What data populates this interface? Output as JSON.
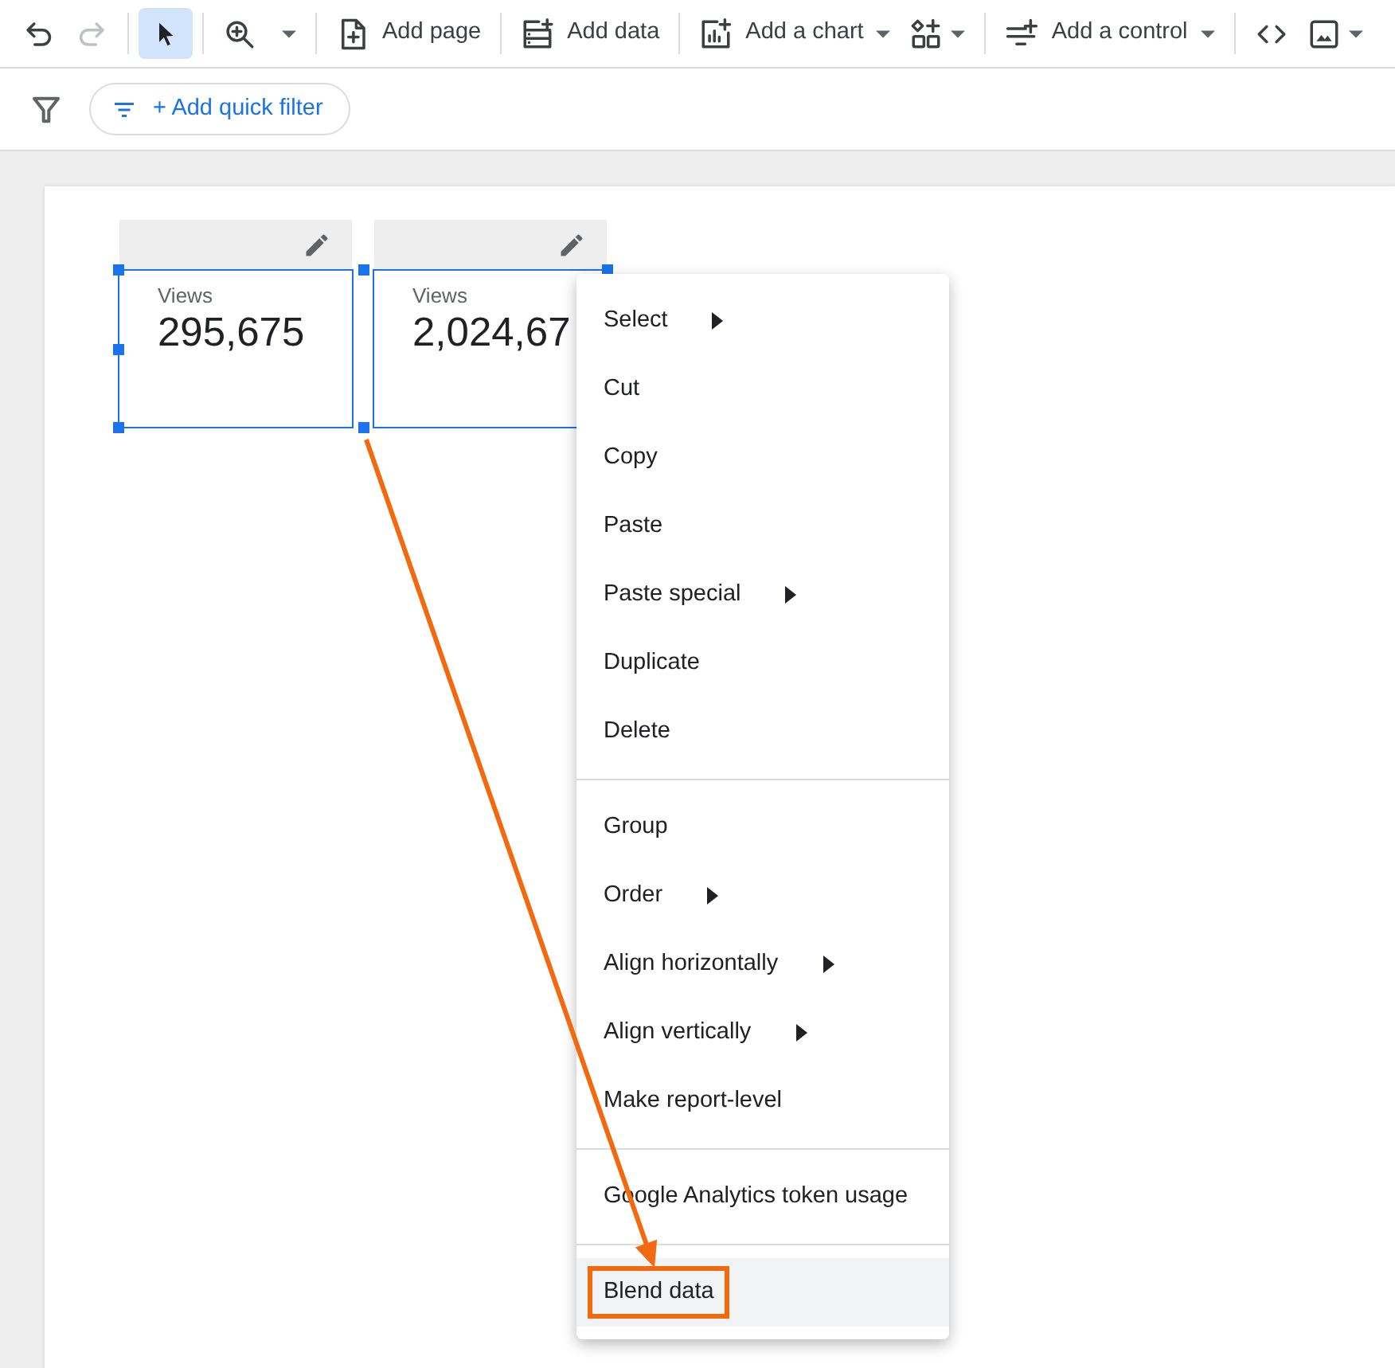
{
  "toolbar": {
    "groups": [
      [
        {
          "kind": "undo",
          "dropdown": false,
          "disabled": false,
          "selected": false
        },
        {
          "kind": "redo",
          "dropdown": false,
          "disabled": true,
          "selected": false
        }
      ],
      [
        {
          "kind": "pointer",
          "dropdown": false,
          "disabled": false,
          "selected": true
        }
      ],
      [
        {
          "kind": "zoom",
          "dropdown": true,
          "disabled": false,
          "selected": false
        }
      ],
      [
        {
          "kind": "page",
          "label": "Add page",
          "dropdown": false,
          "disabled": false,
          "selected": false
        }
      ],
      [
        {
          "kind": "data",
          "label": "Add data",
          "dropdown": false,
          "disabled": false,
          "selected": false
        }
      ],
      [
        {
          "kind": "chart",
          "label": "Add a chart",
          "dropdown": true,
          "disabled": false,
          "selected": false
        },
        {
          "kind": "component",
          "dropdown": true,
          "disabled": false,
          "selected": false
        }
      ],
      [
        {
          "kind": "control",
          "label": "Add a control",
          "dropdown": true,
          "disabled": false,
          "selected": false
        }
      ],
      [
        {
          "kind": "code",
          "dropdown": false,
          "disabled": false,
          "selected": false
        },
        {
          "kind": "image",
          "dropdown": true,
          "disabled": false,
          "selected": false
        }
      ]
    ]
  },
  "filter_bar": {
    "quick_filter": {
      "label": "+ Add quick filter"
    }
  },
  "scorecards": [
    {
      "label": "Views",
      "value": "295,675",
      "selected": true
    },
    {
      "label": "Views",
      "value": "2,024,67",
      "selected": true
    }
  ],
  "context_menu": {
    "sections": [
      [
        {
          "label": "Select",
          "submenu": true,
          "highlighted": false
        },
        {
          "label": "Cut",
          "submenu": false,
          "highlighted": false
        },
        {
          "label": "Copy",
          "submenu": false,
          "highlighted": false
        },
        {
          "label": "Paste",
          "submenu": false,
          "highlighted": false
        },
        {
          "label": "Paste special",
          "submenu": true,
          "highlighted": false
        },
        {
          "label": "Duplicate",
          "submenu": false,
          "highlighted": false
        },
        {
          "label": "Delete",
          "submenu": false,
          "highlighted": false
        }
      ],
      [
        {
          "label": "Group",
          "submenu": false,
          "highlighted": false
        },
        {
          "label": "Order",
          "submenu": true,
          "highlighted": false
        },
        {
          "label": "Align horizontally",
          "submenu": true,
          "highlighted": false
        },
        {
          "label": "Align vertically",
          "submenu": true,
          "highlighted": false
        },
        {
          "label": "Make report-level",
          "submenu": false,
          "highlighted": false
        }
      ],
      [
        {
          "label": "Google Analytics token usage",
          "submenu": false,
          "highlighted": false
        }
      ],
      [
        {
          "label": "Blend data",
          "submenu": false,
          "highlighted": true
        }
      ]
    ]
  }
}
